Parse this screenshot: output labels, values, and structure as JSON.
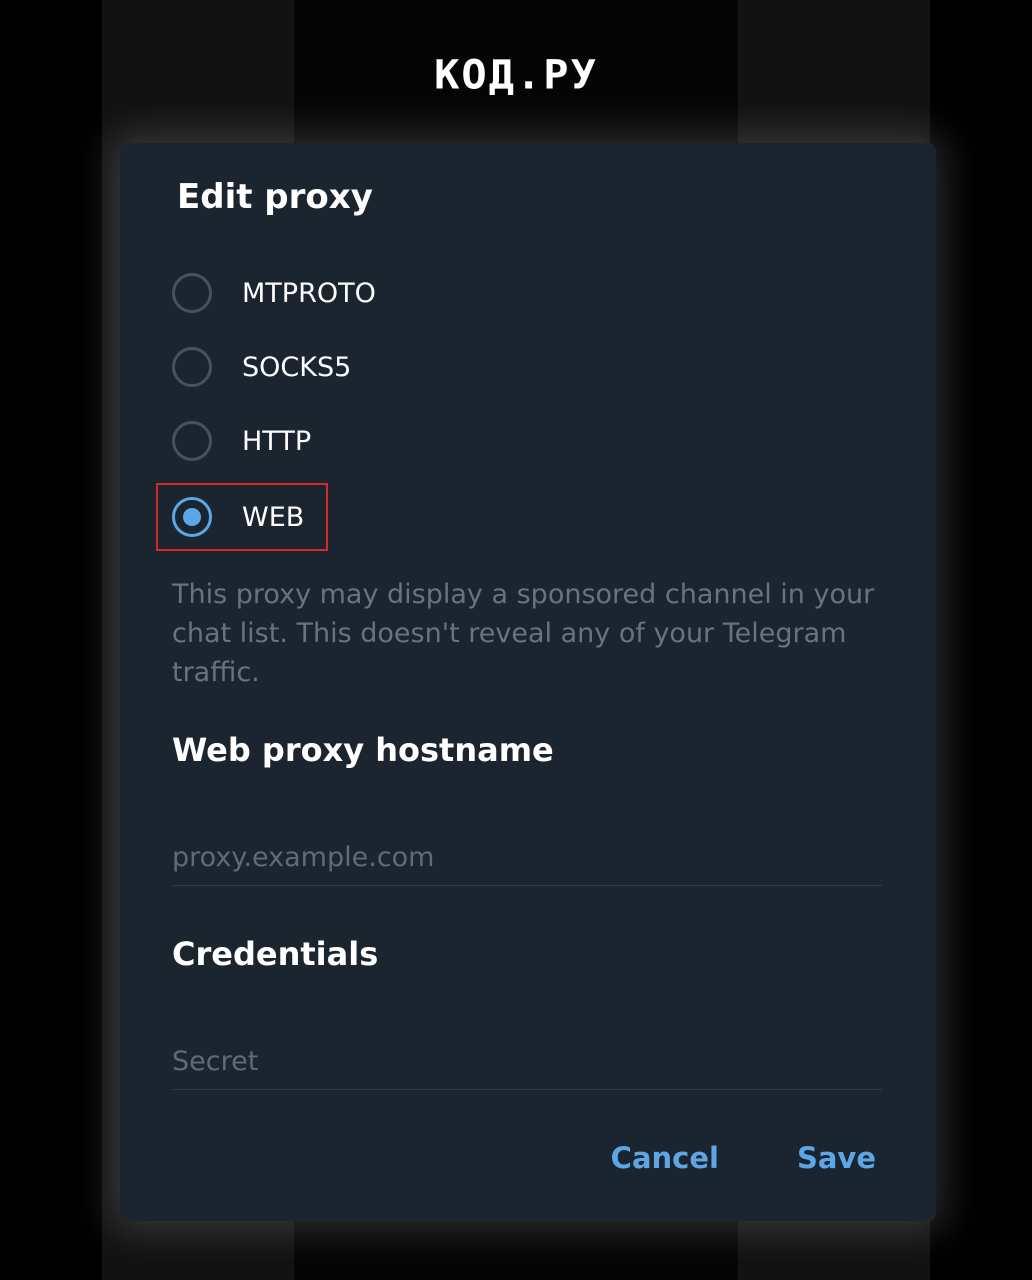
{
  "brand": {
    "logo_text": "КОД.РУ"
  },
  "dialog": {
    "title": "Edit proxy",
    "proxy_types": [
      {
        "label": "MTPROTO",
        "selected": false
      },
      {
        "label": "SOCKS5",
        "selected": false
      },
      {
        "label": "HTTP",
        "selected": false
      },
      {
        "label": "WEB",
        "selected": true
      }
    ],
    "notice": "This proxy may display a sponsored channel in your chat list. This doesn't reveal any of your Telegram traffic.",
    "hostname_section": {
      "title": "Web proxy hostname",
      "placeholder": "proxy.example.com",
      "value": ""
    },
    "credentials_section": {
      "title": "Credentials",
      "placeholder": "Secret",
      "value": ""
    },
    "cancel_label": "Cancel",
    "save_label": "Save"
  },
  "colors": {
    "accent": "#5ca6e6",
    "dialog_bg": "#1b2530",
    "highlight": "#d32a2a"
  }
}
